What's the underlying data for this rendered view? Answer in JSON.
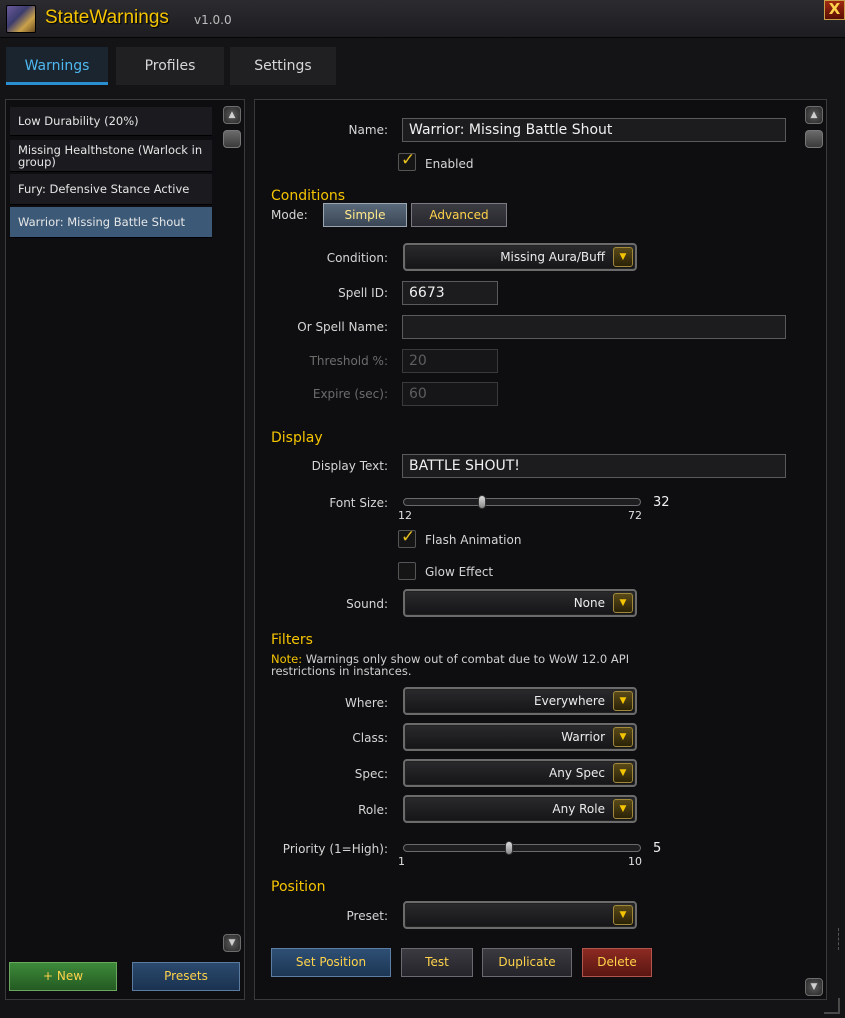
{
  "app": {
    "title": "StateWarnings",
    "version": "v1.0.0",
    "close_label": "X"
  },
  "tabs": [
    {
      "label": "Warnings",
      "active": true
    },
    {
      "label": "Profiles",
      "active": false
    },
    {
      "label": "Settings",
      "active": false
    }
  ],
  "warning_list": {
    "items": [
      {
        "label": "Low Durability (20%)",
        "selected": false
      },
      {
        "label": "Missing Healthstone (Warlock in group)",
        "selected": false
      },
      {
        "label": "Fury: Defensive Stance Active",
        "selected": false
      },
      {
        "label": "Warrior: Missing Battle Shout",
        "selected": true
      }
    ],
    "new_label": "+ New",
    "presets_label": "Presets"
  },
  "editor": {
    "name_label": "Name:",
    "name_value": "Warrior: Missing Battle Shout",
    "enabled_label": "Enabled",
    "enabled_checked": true,
    "conditions": {
      "section": "Conditions",
      "mode_label": "Mode:",
      "mode_simple": "Simple",
      "mode_advanced": "Advanced",
      "condition_label": "Condition:",
      "condition_value": "Missing Aura/Buff",
      "spell_id_label": "Spell ID:",
      "spell_id_value": "6673",
      "spell_name_label": "Or Spell Name:",
      "spell_name_value": "",
      "threshold_label": "Threshold %:",
      "threshold_value": "20",
      "expire_label": "Expire (sec):",
      "expire_value": "60"
    },
    "display": {
      "section": "Display",
      "text_label": "Display Text:",
      "text_value": "BATTLE SHOUT!",
      "font_size_label": "Font Size:",
      "font_size_min": "12",
      "font_size_max": "72",
      "font_size_value": "32",
      "flash_label": "Flash Animation",
      "flash_checked": true,
      "glow_label": "Glow Effect",
      "glow_checked": false,
      "sound_label": "Sound:",
      "sound_value": "None"
    },
    "filters": {
      "section": "Filters",
      "note_key": "Note:",
      "note_text": " Warnings only show out of combat due to WoW 12.0 API restrictions in instances.",
      "where_label": "Where:",
      "where_value": "Everywhere",
      "class_label": "Class:",
      "class_value": "Warrior",
      "spec_label": "Spec:",
      "spec_value": "Any Spec",
      "role_label": "Role:",
      "role_value": "Any Role",
      "priority_label": "Priority (1=High):",
      "priority_min": "1",
      "priority_max": "10",
      "priority_value": "5"
    },
    "position": {
      "section": "Position",
      "preset_label": "Preset:",
      "preset_value": ""
    },
    "actions": {
      "set_position": "Set Position",
      "test": "Test",
      "duplicate": "Duplicate",
      "delete": "Delete"
    }
  },
  "colors": {
    "gold": "#f5c400",
    "tab_active": "#4fb8f0",
    "selected_row": "#3c5a78"
  }
}
